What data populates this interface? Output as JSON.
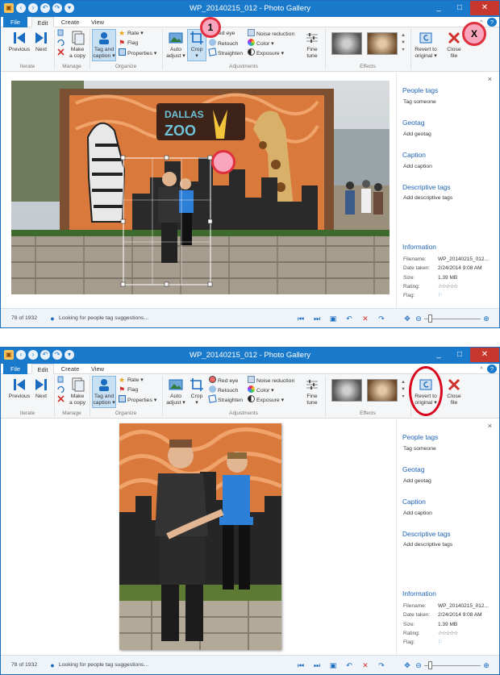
{
  "window": {
    "title": "WP_20140215_012 - Photo Gallery",
    "controls": {
      "help": "?",
      "collapse": "^",
      "minimize": "_",
      "maximize": "□",
      "close": "✕"
    }
  },
  "tabs": [
    "File",
    "Edit",
    "Create",
    "View"
  ],
  "ribbon": {
    "iterate": {
      "previous": "Previous",
      "next": "Next",
      "label": "Iterate"
    },
    "manage": {
      "make_copy_line1": "Make",
      "make_copy_line2": "a copy",
      "label": "Manage"
    },
    "organize": {
      "tag_caption_line1": "Tag and",
      "tag_caption_line2": "caption ▾",
      "rate": "Rate ▾",
      "flag": "Flag",
      "properties": "Properties ▾",
      "label": "Organize"
    },
    "adjustments": {
      "auto_adjust_line1": "Auto",
      "auto_adjust_line2": "adjust ▾",
      "crop_line1": "Crop",
      "crop_line2": "▾",
      "red_eye": "Red eye",
      "red_eye_partial": "ed eye",
      "retouch": "Retouch",
      "straighten": "Straighten",
      "noise_reduction": "Noise reduction",
      "color": "Color ▾",
      "exposure": "Exposure ▾",
      "fine_tune_line1": "Fine",
      "fine_tune_line2": "tune",
      "label": "Adjustments"
    },
    "effects": {
      "label": "Effects"
    },
    "revert": {
      "line1": "Revert to",
      "line2": "original ▾"
    },
    "close_file": {
      "line1": "Close",
      "line2": "file"
    }
  },
  "panel": {
    "close": "×",
    "people_tags": "People tags",
    "tag_someone": "Tag someone",
    "geotag": "Geotag",
    "add_geotag": "Add geotag",
    "caption": "Caption",
    "add_caption": "Add caption",
    "descriptive_tags": "Descriptive tags",
    "add_descriptive_tags": "Add descriptive tags",
    "information": "Information",
    "filename_key": "Filename:",
    "filename": "WP_20140215_012...",
    "date_key": "Date taken:",
    "date": "2/24/2014  9:08 AM",
    "size_key": "Size:",
    "size": "1.39 MB",
    "rating_key": "Rating:",
    "rating": "☆☆☆☆☆",
    "flag_key": "Flag:",
    "flag": "⚐"
  },
  "photo_sign": {
    "line1": "DALLAS",
    "line2": "ZOO"
  },
  "status": {
    "count": "78 of 1932",
    "message": "Looking for people tag suggestions..."
  },
  "annotations": {
    "step1": "1",
    "x": "X"
  },
  "colors": {
    "titlebar": "#1979ca",
    "link": "#1e63b4",
    "close_red": "#c8372d",
    "annotation_red": "#e0303f"
  }
}
